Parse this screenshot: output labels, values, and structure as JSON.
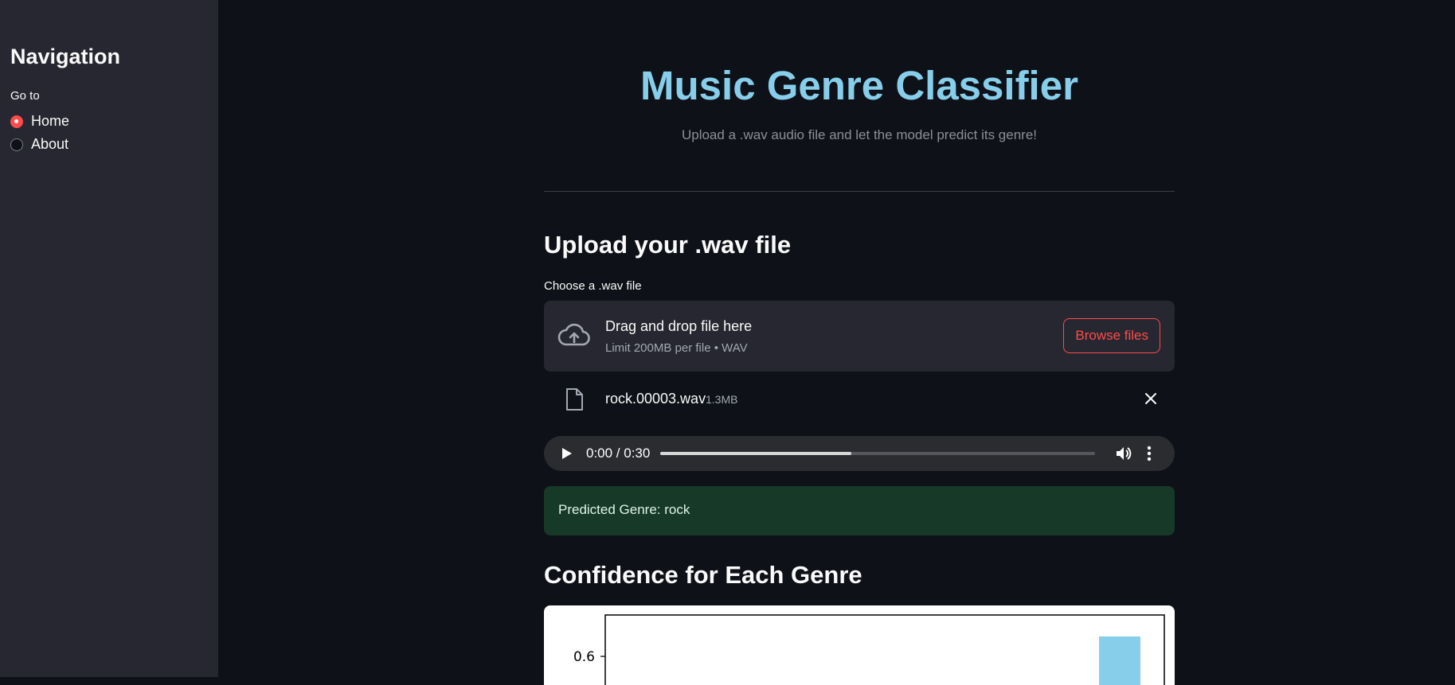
{
  "sidebar": {
    "title": "Navigation",
    "radio_label": "Go to",
    "options": [
      {
        "label": "Home",
        "selected": true
      },
      {
        "label": "About",
        "selected": false
      }
    ]
  },
  "header": {
    "title": "Music Genre Classifier",
    "subtitle": "Upload a .wav audio file and let the model predict its genre!"
  },
  "upload": {
    "heading": "Upload your .wav file",
    "label": "Choose a .wav file",
    "drop_text": "Drag and drop file here",
    "limit_text": "Limit 200MB per file • WAV",
    "browse_label": "Browse files",
    "file": {
      "name": "rock.00003.wav",
      "size": "1.3MB"
    }
  },
  "player": {
    "time": "0:00 / 0:30",
    "progress_fraction": 0.44
  },
  "result": {
    "text": "Predicted Genre: rock"
  },
  "confidence": {
    "heading": "Confidence for Each Genre"
  },
  "chart_data": {
    "type": "bar",
    "visible_ticks": [
      "0.6"
    ],
    "bars": [
      {
        "value": 0.65,
        "color": "#87ceeb"
      }
    ]
  },
  "colors": {
    "accent": "#ff4b4b",
    "title": "#87ceeb",
    "success_bg": "#173928"
  }
}
